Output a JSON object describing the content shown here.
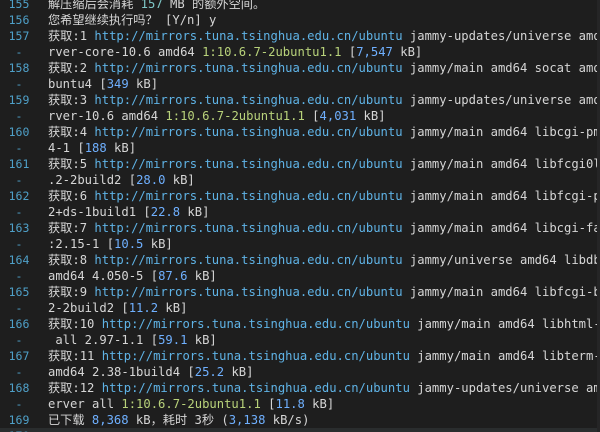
{
  "rows": [
    {
      "gutter": "155",
      "parts": [
        {
          "t": "解压缩后会消耗 ",
          "c": ""
        },
        {
          "t": "157",
          "c": "num"
        },
        {
          "t": " MB 的额外空间。",
          "c": ""
        }
      ]
    },
    {
      "gutter": "156",
      "parts": [
        {
          "t": "您希望继续执行吗？ [Y/n] y",
          "c": ""
        }
      ]
    },
    {
      "gutter": "157",
      "parts": [
        {
          "t": "获取:1 ",
          "c": ""
        },
        {
          "t": "http://mirrors.tuna.tsinghua.edu.cn/ubuntu",
          "c": "url"
        },
        {
          "t": " jammy-updates/universe amd64 m",
          "c": ""
        }
      ]
    },
    {
      "gutter": "-",
      "parts": [
        {
          "t": "rver-core-10.6 amd64 ",
          "c": ""
        },
        {
          "t": "1:10.6.7-2ubuntu1.1",
          "c": "ver"
        },
        {
          "t": " [",
          "c": ""
        },
        {
          "t": "7,547",
          "c": "size"
        },
        {
          "t": " kB]",
          "c": ""
        }
      ]
    },
    {
      "gutter": "158",
      "parts": [
        {
          "t": "获取:2 ",
          "c": ""
        },
        {
          "t": "http://mirrors.tuna.tsinghua.edu.cn/ubuntu",
          "c": "url"
        },
        {
          "t": " jammy/main amd64 socat amd64 ",
          "c": ""
        }
      ]
    },
    {
      "gutter": "-",
      "parts": [
        {
          "t": "buntu4 [",
          "c": ""
        },
        {
          "t": "349",
          "c": "size"
        },
        {
          "t": " kB]",
          "c": ""
        }
      ]
    },
    {
      "gutter": "159",
      "parts": [
        {
          "t": "获取:3 ",
          "c": ""
        },
        {
          "t": "http://mirrors.tuna.tsinghua.edu.cn/ubuntu",
          "c": "url"
        },
        {
          "t": " jammy-updates/universe amd64 m",
          "c": ""
        }
      ]
    },
    {
      "gutter": "-",
      "parts": [
        {
          "t": "rver-10.6 amd64 ",
          "c": ""
        },
        {
          "t": "1:10.6.7-2ubuntu1.1",
          "c": "ver"
        },
        {
          "t": " [",
          "c": ""
        },
        {
          "t": "4,031",
          "c": "size"
        },
        {
          "t": " kB]",
          "c": ""
        }
      ]
    },
    {
      "gutter": "160",
      "parts": [
        {
          "t": "获取:4 ",
          "c": ""
        },
        {
          "t": "http://mirrors.tuna.tsinghua.edu.cn/ubuntu",
          "c": "url"
        },
        {
          "t": " jammy/main amd64 libcgi-pm-pe",
          "c": ""
        }
      ]
    },
    {
      "gutter": "-",
      "parts": [
        {
          "t": "4-1 [",
          "c": ""
        },
        {
          "t": "188",
          "c": "size"
        },
        {
          "t": " kB]",
          "c": ""
        }
      ]
    },
    {
      "gutter": "161",
      "parts": [
        {
          "t": "获取:5 ",
          "c": ""
        },
        {
          "t": "http://mirrors.tuna.tsinghua.edu.cn/ubuntu",
          "c": "url"
        },
        {
          "t": " jammy/main amd64 libfcgi0ldbl",
          "c": ""
        }
      ]
    },
    {
      "gutter": "-",
      "parts": [
        {
          "t": ".2-2build2 [",
          "c": ""
        },
        {
          "t": "28.0",
          "c": "size"
        },
        {
          "t": " kB]",
          "c": ""
        }
      ]
    },
    {
      "gutter": "162",
      "parts": [
        {
          "t": "获取:6 ",
          "c": ""
        },
        {
          "t": "http://mirrors.tuna.tsinghua.edu.cn/ubuntu",
          "c": "url"
        },
        {
          "t": " jammy/main amd64 libfcgi-perl",
          "c": ""
        }
      ]
    },
    {
      "gutter": "-",
      "parts": [
        {
          "t": "2+ds-1build1 [",
          "c": ""
        },
        {
          "t": "22.8",
          "c": "size"
        },
        {
          "t": " kB]",
          "c": ""
        }
      ]
    },
    {
      "gutter": "163",
      "parts": [
        {
          "t": "获取:7 ",
          "c": ""
        },
        {
          "t": "http://mirrors.tuna.tsinghua.edu.cn/ubuntu",
          "c": "url"
        },
        {
          "t": " jammy/main amd64 libcgi-fast-p",
          "c": ""
        }
      ]
    },
    {
      "gutter": "-",
      "parts": [
        {
          "t": ":2.15-1 [",
          "c": ""
        },
        {
          "t": "10.5",
          "c": "size"
        },
        {
          "t": " kB]",
          "c": ""
        }
      ]
    },
    {
      "gutter": "164",
      "parts": [
        {
          "t": "获取:8 ",
          "c": ""
        },
        {
          "t": "http://mirrors.tuna.tsinghua.edu.cn/ubuntu",
          "c": "url"
        },
        {
          "t": " jammy/universe amd64 libdbd-my",
          "c": ""
        }
      ]
    },
    {
      "gutter": "-",
      "parts": [
        {
          "t": "amd64 4.050-5 [",
          "c": ""
        },
        {
          "t": "87.6",
          "c": "size"
        },
        {
          "t": " kB]",
          "c": ""
        }
      ]
    },
    {
      "gutter": "165",
      "parts": [
        {
          "t": "获取:9 ",
          "c": ""
        },
        {
          "t": "http://mirrors.tuna.tsinghua.edu.cn/ubuntu",
          "c": "url"
        },
        {
          "t": " jammy/main amd64 libfcgi-bin a",
          "c": ""
        }
      ]
    },
    {
      "gutter": "-",
      "parts": [
        {
          "t": "2-2build2 [",
          "c": ""
        },
        {
          "t": "11.2",
          "c": "size"
        },
        {
          "t": " kB]",
          "c": ""
        }
      ]
    },
    {
      "gutter": "166",
      "parts": [
        {
          "t": "获取:10 ",
          "c": ""
        },
        {
          "t": "http://mirrors.tuna.tsinghua.edu.cn/ubuntu",
          "c": "url"
        },
        {
          "t": " jammy/main amd64 libhtml-temp",
          "c": ""
        }
      ]
    },
    {
      "gutter": "-",
      "parts": [
        {
          "t": " all 2.97-1.1 [",
          "c": ""
        },
        {
          "t": "59.1",
          "c": "size"
        },
        {
          "t": " kB]",
          "c": ""
        }
      ]
    },
    {
      "gutter": "167",
      "parts": [
        {
          "t": "获取:11 ",
          "c": ""
        },
        {
          "t": "http://mirrors.tuna.tsinghua.edu.cn/ubuntu",
          "c": "url"
        },
        {
          "t": " jammy/main amd64 libterm-read",
          "c": ""
        }
      ]
    },
    {
      "gutter": "-",
      "parts": [
        {
          "t": "amd64 2.38-1build4 [",
          "c": ""
        },
        {
          "t": "25.2",
          "c": "size"
        },
        {
          "t": " kB]",
          "c": ""
        }
      ]
    },
    {
      "gutter": "168",
      "parts": [
        {
          "t": "获取:12 ",
          "c": ""
        },
        {
          "t": "http://mirrors.tuna.tsinghua.edu.cn/ubuntu",
          "c": "url"
        },
        {
          "t": " jammy-updates/universe amd64 ",
          "c": ""
        }
      ]
    },
    {
      "gutter": "-",
      "parts": [
        {
          "t": "erver all ",
          "c": ""
        },
        {
          "t": "1:10.6.7-2ubuntu1.1",
          "c": "ver"
        },
        {
          "t": " [",
          "c": ""
        },
        {
          "t": "11.8",
          "c": "size"
        },
        {
          "t": " kB]",
          "c": ""
        }
      ]
    },
    {
      "gutter": "169",
      "parts": [
        {
          "t": "已下载 ",
          "c": ""
        },
        {
          "t": "8,368",
          "c": "size"
        },
        {
          "t": " kB，耗时 3秒 (",
          "c": ""
        },
        {
          "t": "3,138",
          "c": "size"
        },
        {
          "t": " kB/s)",
          "c": ""
        }
      ]
    },
    {
      "gutter": "170",
      "parts": [
        {
          "t": "",
          "c": ""
        }
      ]
    }
  ]
}
